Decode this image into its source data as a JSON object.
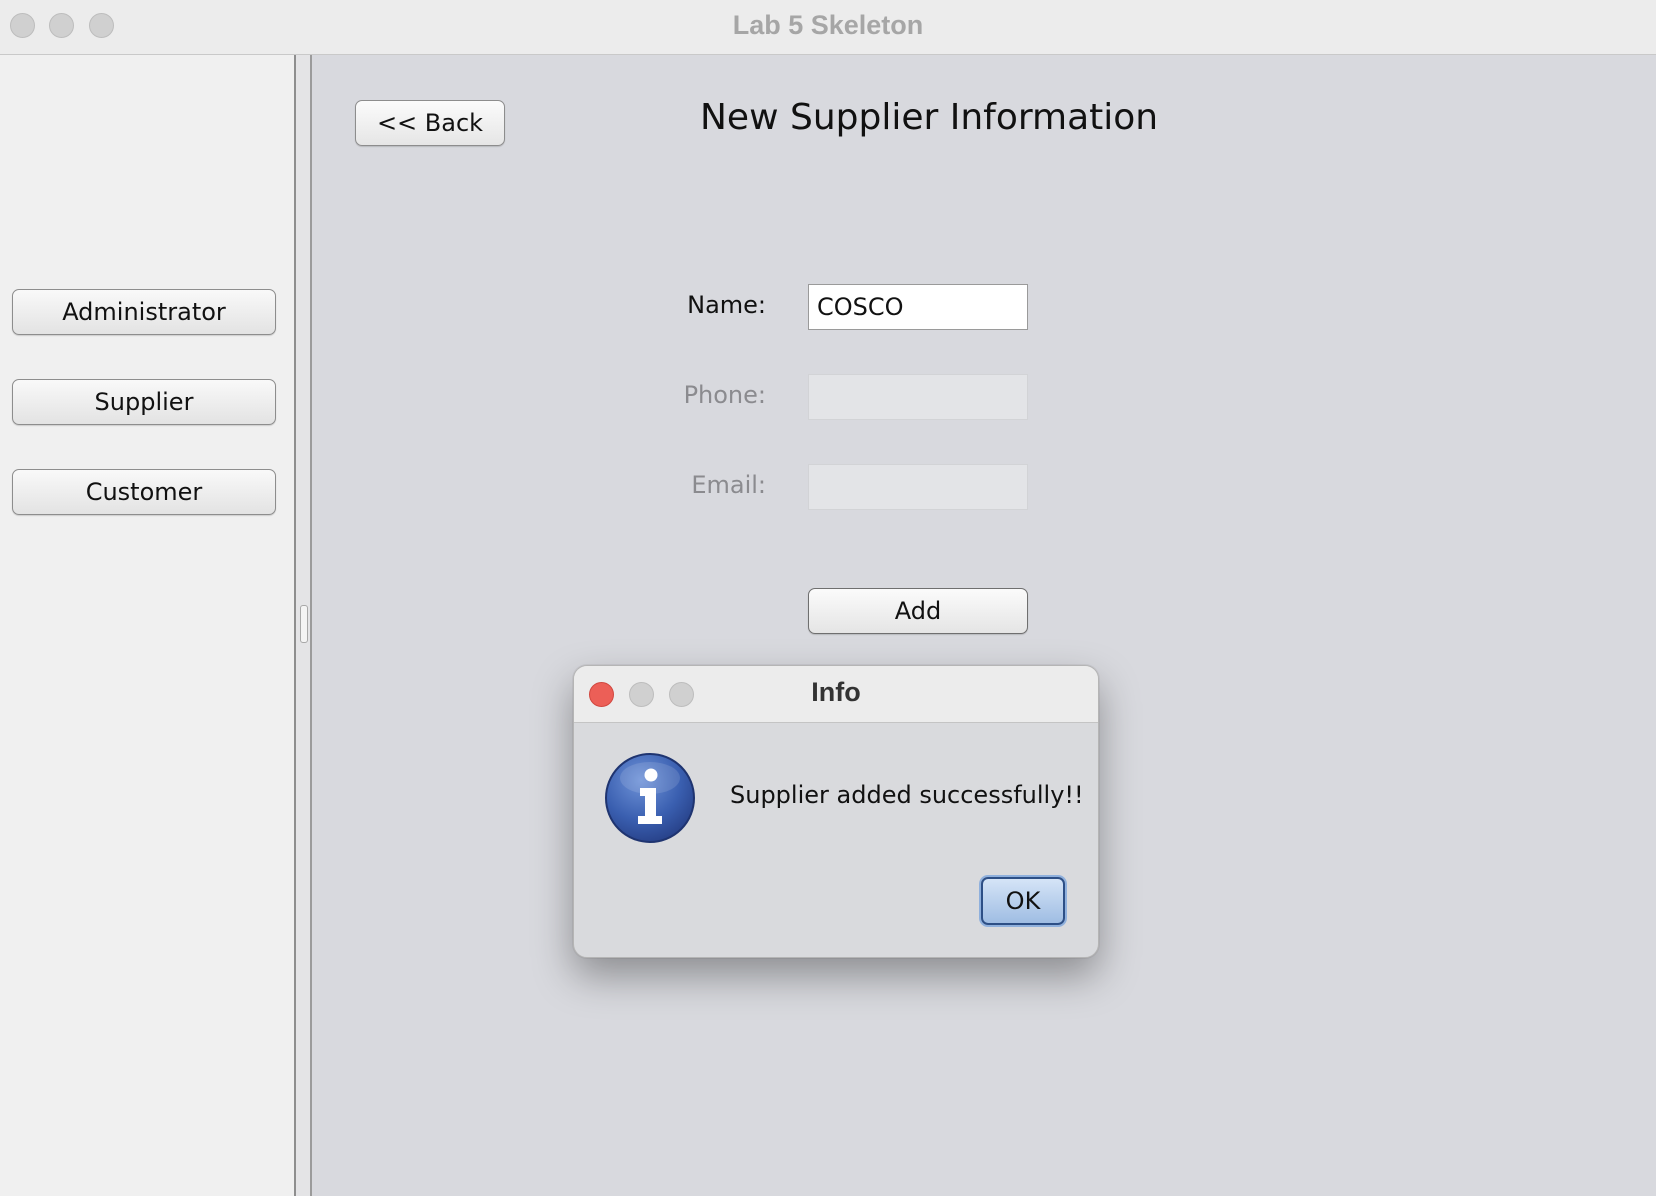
{
  "window": {
    "title": "Lab 5 Skeleton"
  },
  "sidebar": {
    "items": [
      {
        "label": "Administrator"
      },
      {
        "label": "Supplier"
      },
      {
        "label": "Customer"
      }
    ]
  },
  "main": {
    "back_label": "<< Back",
    "title": "New Supplier Information",
    "fields": {
      "name": {
        "label": "Name:",
        "value": "COSCO"
      },
      "phone": {
        "label": "Phone:",
        "value": ""
      },
      "email": {
        "label": "Email:",
        "value": ""
      }
    },
    "add_label": "Add"
  },
  "dialog": {
    "title": "Info",
    "message": "Supplier added successfully!!",
    "ok_label": "OK",
    "icon": "info-icon"
  },
  "colors": {
    "dialog_close": "#ec5f57",
    "info_icon_blue": "#3a5fb0",
    "ok_button": "#9fbde3"
  }
}
